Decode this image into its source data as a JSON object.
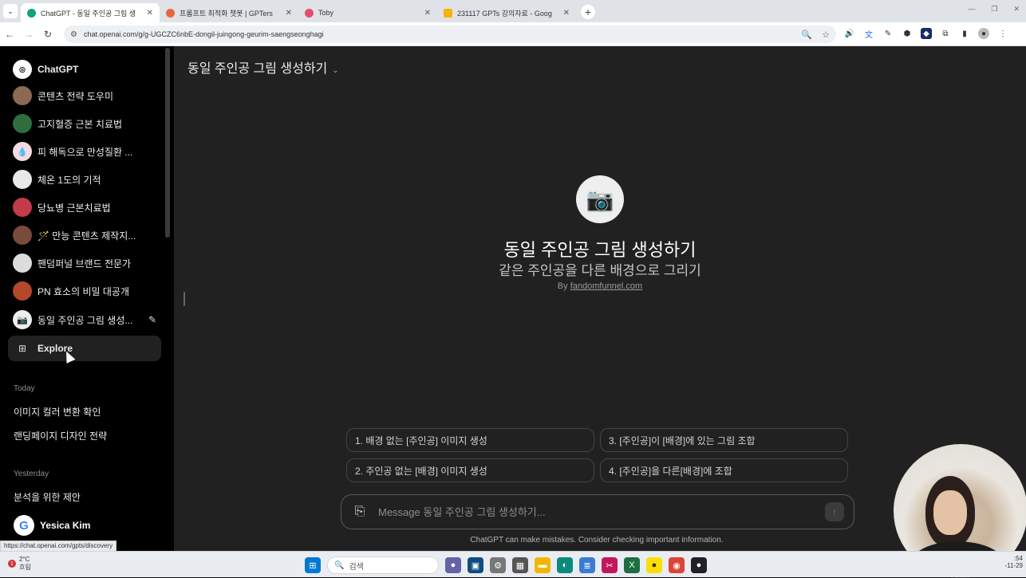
{
  "browser": {
    "tabs": [
      {
        "title": "ChatGPT - 동일 주인공 그림 생",
        "favicon_color": "#10a37f",
        "active": true
      },
      {
        "title": "프롬프트 최적화 챗봇 | GPTers",
        "favicon_color": "#e8663d",
        "active": false
      },
      {
        "title": "Toby",
        "favicon_color": "#e04e6b",
        "active": false
      },
      {
        "title": "231117 GPTs 강의자료 - Goog",
        "favicon_color": "#f4b400",
        "active": false
      }
    ],
    "url": "chat.openai.com/g/g-UGCZC6nbE-dongil-juingong-geurim-saengseonghagi",
    "status_url": "https://chat.openai.com/gpts/discovery"
  },
  "sidebar": {
    "items": [
      {
        "label": "ChatGPT",
        "icon": "openai-logo-icon",
        "bg": "#fff",
        "bold": true
      },
      {
        "label": "콘텐츠 전략 도우미",
        "icon": "gpt-avatar-icon",
        "bg": "#8a6a52"
      },
      {
        "label": "고지혈증 근본 치료법",
        "icon": "gpt-avatar-icon",
        "bg": "#2f6d3e"
      },
      {
        "label": "피 해독으로 만성질환 ...",
        "icon": "gpt-avatar-icon",
        "bg": "#f7d9e3"
      },
      {
        "label": "체온 1도의 기적",
        "icon": "gpt-avatar-icon",
        "bg": "#e8e8e8"
      },
      {
        "label": "당뇨병 근본치료법",
        "icon": "gpt-avatar-icon",
        "bg": "#c23b4a"
      },
      {
        "label": "🪄 만능 콘텐츠 제작지...",
        "icon": "gpt-avatar-icon",
        "bg": "#7a4a3a"
      },
      {
        "label": "팬덤퍼널 브랜드 전문가",
        "icon": "gpt-avatar-icon",
        "bg": "#dcdcdc"
      },
      {
        "label": "PN 효소의 비밀 대공개",
        "icon": "gpt-avatar-icon",
        "bg": "#b5472a",
        "bold": true
      },
      {
        "label": "동일 주인공 그림 생성...",
        "icon": "camera-icon",
        "bg": "#eeeeee"
      }
    ],
    "explore_label": "Explore",
    "today_heading": "Today",
    "today_chats": [
      "이미지 컬러 변환 확인",
      "랜딩페이지 디자인 전략"
    ],
    "yesterday_heading": "Yesterday",
    "yesterday_chats": [
      "분석을 위한 제안"
    ],
    "user_name": "Yesica Kim"
  },
  "main": {
    "header_title": "동일 주인공 그림 생성하기",
    "gpt_name": "동일 주인공 그림 생성하기",
    "gpt_description": "같은 주인공을 다른 배경으로 그리기",
    "by_prefix": "By",
    "by_author": "fandomfunnel.com",
    "starters": [
      "1. 배경 없는 [주인공] 이미지 생성",
      "3. [주인공]이 [배경]에 있는 그림 조합",
      "2. 주인공 없는 [배경] 이미지 생성",
      "4. [주인공]을 다른[배경]에 조합"
    ],
    "composer_placeholder": "Message 동일 주인공 그림 생성하기...",
    "disclaimer": "ChatGPT can make mistakes. Consider checking important information."
  },
  "taskbar": {
    "weather_temp": "2°C",
    "weather_desc": "흐림",
    "notification_count": "1",
    "search_placeholder": "검색",
    "clock_time": ":54",
    "clock_date": "-11-29"
  }
}
